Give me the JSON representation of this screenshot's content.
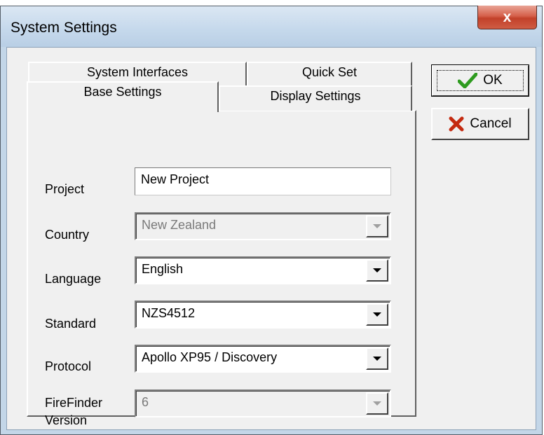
{
  "window": {
    "title": "System Settings",
    "close_label": "x"
  },
  "tabs": {
    "row_back": [
      {
        "label": "System Interfaces"
      },
      {
        "label": "Quick Set"
      }
    ],
    "row_front": [
      {
        "label": "Base Settings",
        "active": true
      },
      {
        "label": "Display Settings"
      }
    ]
  },
  "form": {
    "project": {
      "label": "Project",
      "value": "New Project"
    },
    "country": {
      "label": "Country",
      "value": "New Zealand",
      "enabled": false
    },
    "language": {
      "label": "Language",
      "value": "English"
    },
    "standard": {
      "label": "Standard",
      "value": "NZS4512"
    },
    "protocol": {
      "label": "Protocol",
      "value": "Apollo XP95 / Discovery"
    },
    "firefinder_version": {
      "label_line1": "FireFinder",
      "label_line2": "Version",
      "value": "6",
      "enabled": false
    }
  },
  "buttons": {
    "ok": {
      "label": "OK",
      "icon": "checkmark-icon",
      "color": "#2e9b1f"
    },
    "cancel": {
      "label": "Cancel",
      "icon": "x-mark-icon",
      "color": "#c42a10"
    }
  },
  "colors": {
    "titlebar": "#c6d9ec",
    "close_button": "#c7452d",
    "face": "#f0f0f0"
  }
}
